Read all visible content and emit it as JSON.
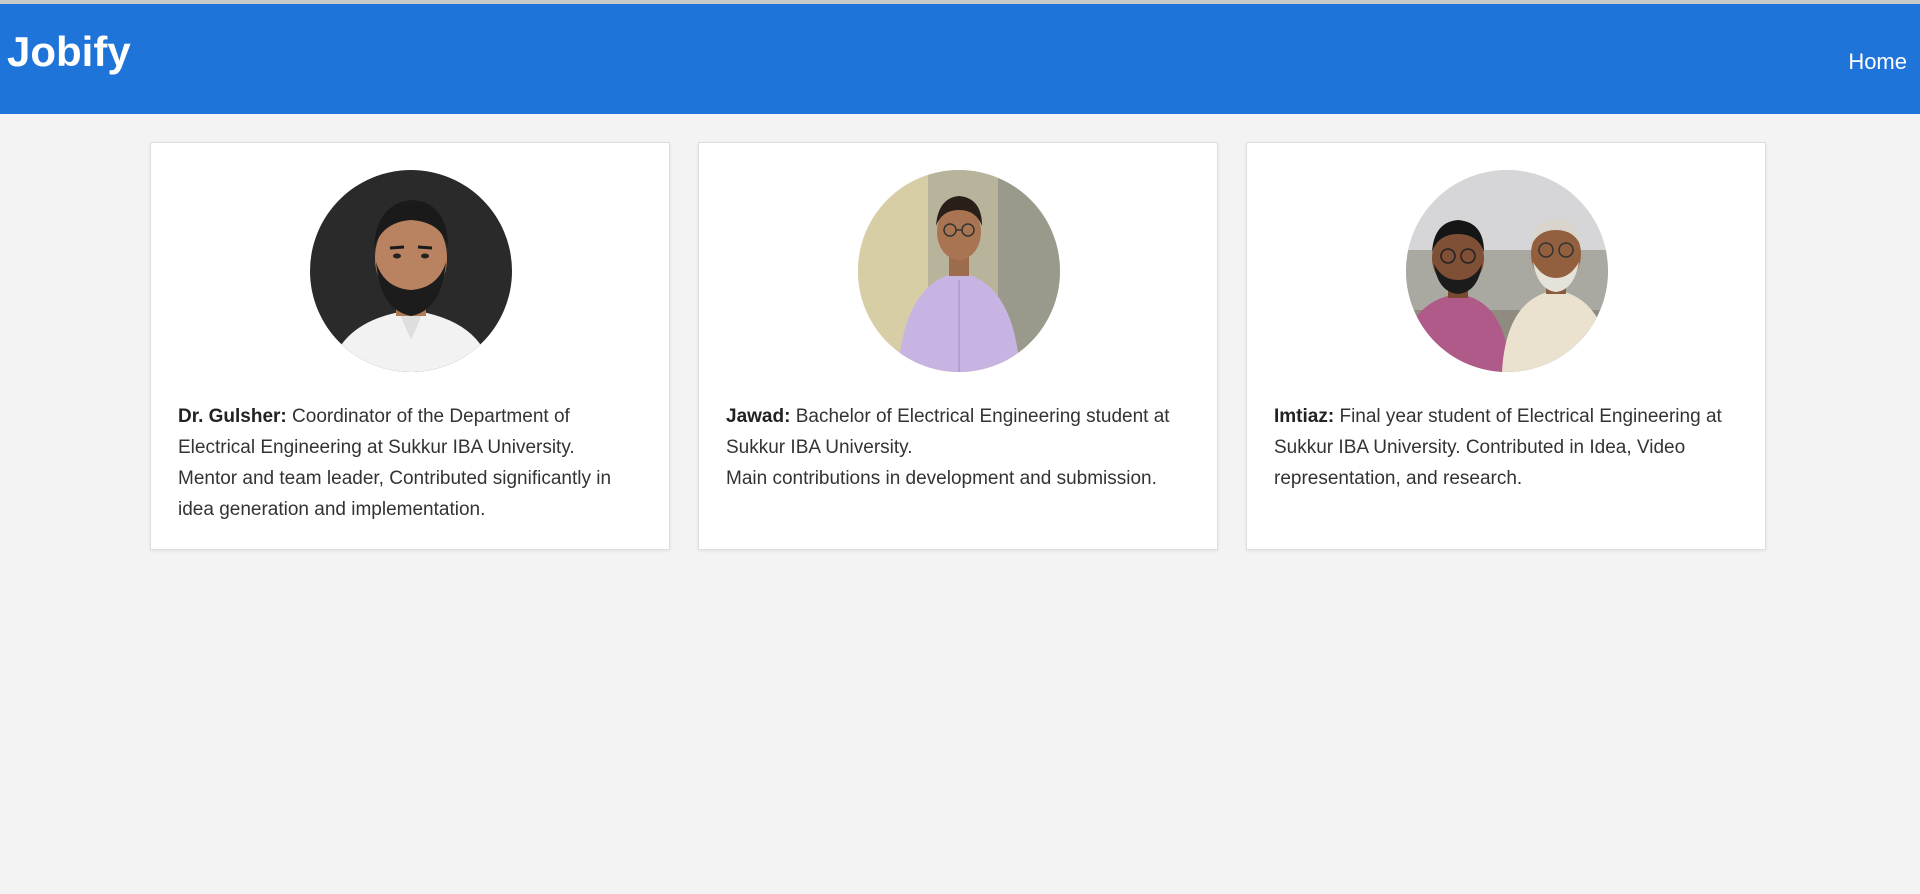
{
  "navbar": {
    "brand": "Jobify",
    "home_label": "Home",
    "background": "#1f74d9"
  },
  "team": [
    {
      "name": "Dr. Gulsher:",
      "bio_line1": " Coordinator of the Department of Electrical Engineering at Sukkur IBA University.",
      "bio_line2": "Mentor and team leader, Contributed significantly in idea generation and implementation.",
      "photo": "avatar-photo"
    },
    {
      "name": "Jawad:",
      "bio_line1": " Bachelor of Electrical Engineering student at Sukkur IBA University.",
      "bio_line2": "Main contributions in development and submission.",
      "photo": "avatar-photo"
    },
    {
      "name": "Imtiaz:",
      "bio_line1": " Final year student of Electrical Engineering at Sukkur IBA University. Contributed in Idea, Video representation, and research.",
      "bio_line2": "",
      "photo": "avatar-photo"
    }
  ]
}
